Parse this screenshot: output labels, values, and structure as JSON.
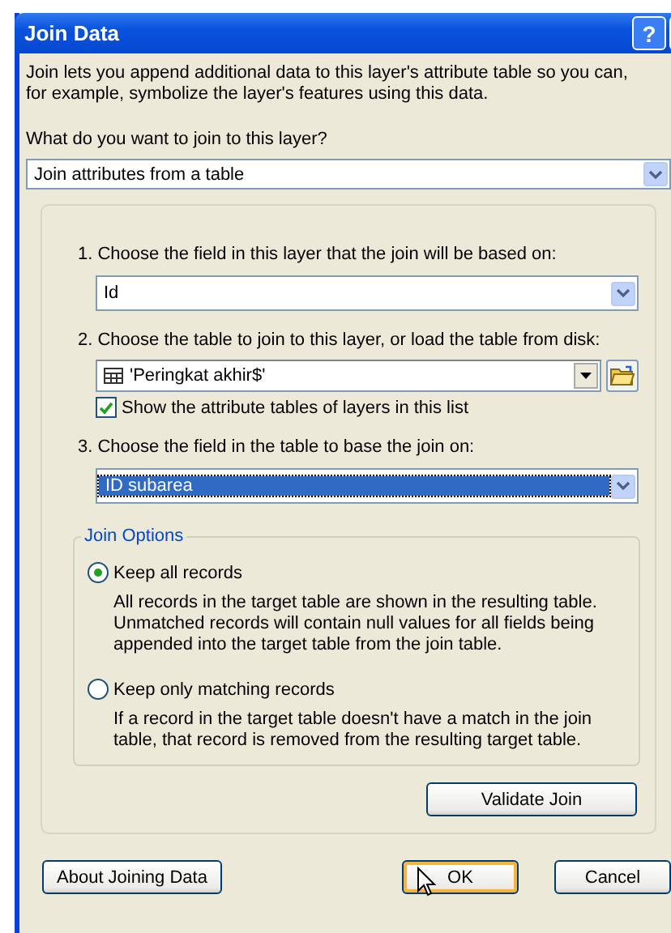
{
  "window": {
    "title": "Join Data",
    "help_button": "?"
  },
  "intro": "Join lets you append additional data to this layer's attribute table so you can, for example, symbolize the layer's features using this data.",
  "question": "What do you want to join to this layer?",
  "join_type": {
    "value": "Join attributes from a table"
  },
  "steps": [
    {
      "label": "1.  Choose the field in this layer that the join will be based on:",
      "kind": "dropdown",
      "value": "Id",
      "selected": false
    },
    {
      "label": "2.  Choose the table to join to this layer, or load the table from disk:",
      "kind": "table",
      "value": "'Peringkat akhir$'",
      "selected": false,
      "checkbox": {
        "label": "Show the attribute tables of layers in this list",
        "checked": true
      }
    },
    {
      "label": "3.  Choose the field in the table to base the join on:",
      "kind": "dropdown",
      "value": "ID subarea",
      "selected": true
    }
  ],
  "join_options": {
    "title": "Join Options",
    "options": [
      {
        "label": "Keep all records",
        "selected": true,
        "description": "All records in the target table are shown in the resulting table. Unmatched records will contain null values for all fields being appended into the target table from the join table."
      },
      {
        "label": "Keep only matching records",
        "selected": false,
        "description": "If a record in the target table doesn't have a match in the join table, that record is removed from the resulting target table."
      }
    ]
  },
  "validate_button": "Validate Join",
  "buttons": [
    {
      "label": "About Joining Data",
      "kind": "help"
    },
    {
      "label": "OK",
      "kind": "ok"
    },
    {
      "label": "Cancel",
      "kind": "cancel"
    }
  ]
}
